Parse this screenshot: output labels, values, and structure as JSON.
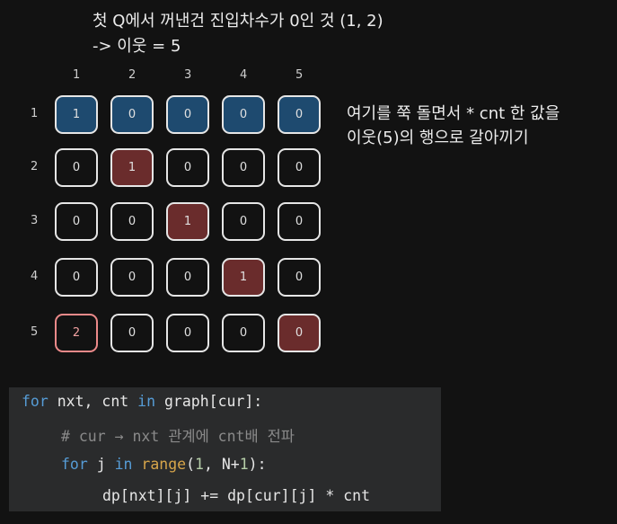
{
  "annotations": {
    "title_line1": "첫 Q에서 꺼낸건 진입차수가 0인 것 (1, 2)",
    "title_line2": "-> 이웃 = 5",
    "side_line1": "여기를 쭉 돌면서 * cnt 한 값을",
    "side_line2": "이웃(5)의 행으로 갈아끼기"
  },
  "matrix": {
    "col_headers": [
      "1",
      "2",
      "3",
      "4",
      "5"
    ],
    "row_headers": [
      "1",
      "2",
      "3",
      "4",
      "5"
    ],
    "rows": [
      [
        "1",
        "0",
        "0",
        "0",
        "0"
      ],
      [
        "0",
        "1",
        "0",
        "0",
        "0"
      ],
      [
        "0",
        "0",
        "1",
        "0",
        "0"
      ],
      [
        "0",
        "0",
        "0",
        "1",
        "0"
      ],
      [
        "2",
        "0",
        "0",
        "0",
        "0"
      ]
    ],
    "highlight_colors": {
      "row_highlight": "#1e4a6f",
      "diagonal": "#6a2c2c",
      "result_border": "#ec8a8a"
    }
  },
  "code": {
    "line1": {
      "kw1": "for",
      "a": " nxt, cnt ",
      "kw2": "in",
      "b": " graph[cur]:"
    },
    "line2": {
      "comment": "# cur → nxt 관계에 cnt배 전파"
    },
    "line3": {
      "kw1": "for",
      "a": " j ",
      "kw2": "in",
      "fn": " range",
      "p1": "(",
      "n1": "1",
      "p2": ", N+",
      "n2": "1",
      "p3": "):"
    },
    "line4": {
      "text": "dp[nxt][j] += dp[cur][j] * cnt"
    }
  }
}
